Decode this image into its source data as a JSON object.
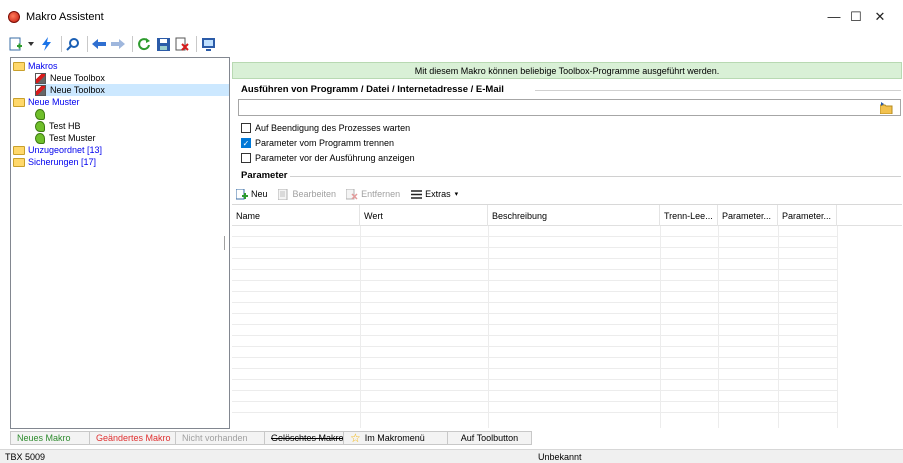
{
  "window": {
    "title": "Makro Assistent",
    "minimize_glyph": "—",
    "maximize_glyph": "☐",
    "close_glyph": "✕"
  },
  "toolbar": {
    "icons": [
      "new-icon",
      "dropdown-arrow-icon",
      "lightning-icon",
      "search-icon",
      "back-arrow-icon",
      "forward-arrow-icon",
      "refresh-icon",
      "save-icon",
      "delete-icon",
      "monitor-icon"
    ]
  },
  "tree": {
    "items": [
      {
        "label": "Makros",
        "icon": "folder-icon",
        "level": 0
      },
      {
        "label": "Neue Toolbox",
        "icon": "macro-icon",
        "level": 1
      },
      {
        "label": "Neue Toolbox",
        "icon": "macro-icon",
        "level": 1,
        "selected": true
      },
      {
        "label": "Neue Muster",
        "icon": "folder-icon",
        "level": 0
      },
      {
        "label": "",
        "icon": "pattern-icon",
        "level": 1
      },
      {
        "label": "Test HB",
        "icon": "pattern-icon",
        "level": 1
      },
      {
        "label": "Test Muster",
        "icon": "pattern-icon",
        "level": 1
      },
      {
        "label": "Unzugeordnet [13]",
        "icon": "folder-icon",
        "level": 0
      },
      {
        "label": "Sicherungen [17]",
        "icon": "folder-icon",
        "level": 0
      }
    ]
  },
  "info": {
    "message": "Mit diesem Makro können beliebige Toolbox-Programme ausgeführt werden."
  },
  "execute": {
    "title": "Ausführen von Programm / Datei / Internetadresse / E-Mail",
    "path_value": ""
  },
  "options": [
    {
      "label": "Auf Beendigung des Prozesses warten",
      "checked": false
    },
    {
      "label": "Parameter vom Programm trennen",
      "checked": true
    },
    {
      "label": "Parameter vor der Ausführung anzeigen",
      "checked": false
    }
  ],
  "parameter": {
    "title": "Parameter",
    "toolbar": {
      "new": "Neu",
      "edit": "Bearbeiten",
      "remove": "Entfernen",
      "extras": "Extras"
    },
    "columns": [
      "Name",
      "Wert",
      "Beschreibung",
      "Trenn-Lee...",
      "Parameter...",
      "Parameter..."
    ]
  },
  "legend": {
    "items": [
      {
        "label": "Neues Makro",
        "color": "#2e8b2e"
      },
      {
        "label": "Geändertes Makro",
        "color": "#e03030"
      },
      {
        "label": "Nicht vorhanden",
        "color": "#a0a0a0"
      },
      {
        "label": "Gelöschtes Makro",
        "color": "#000000"
      },
      {
        "label": "Im Makromenü",
        "color": "#000000"
      },
      {
        "label": "Auf Toolbutton",
        "color": "#000000"
      }
    ]
  },
  "status": {
    "left": "TBX 5009",
    "middle": "Unbekannt"
  }
}
